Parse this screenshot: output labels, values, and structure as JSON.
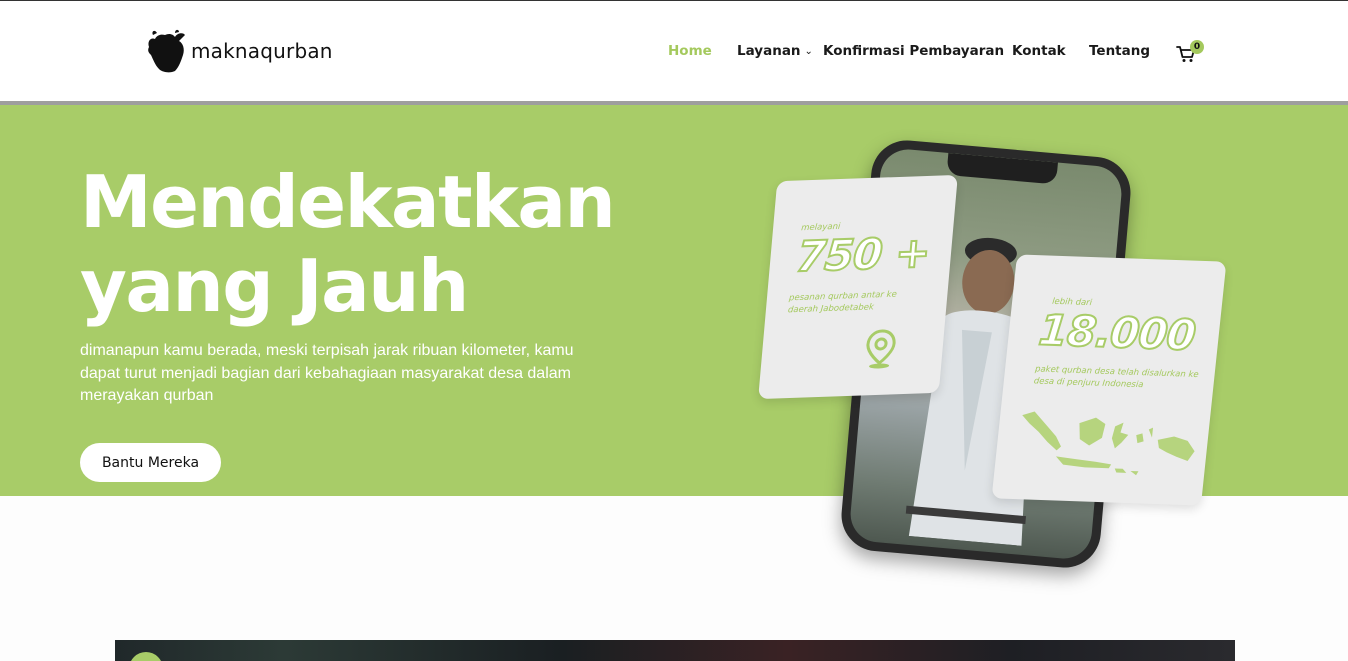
{
  "brand": {
    "name": "maknaqurban",
    "logo_icon": "bull-head-icon"
  },
  "nav": {
    "items": [
      {
        "label": "Home",
        "active": true
      },
      {
        "label": "Layanan",
        "has_dropdown": true
      },
      {
        "label": "Konfirmasi Pembayaran"
      },
      {
        "label": "Kontak"
      },
      {
        "label": "Tentang"
      }
    ],
    "cart": {
      "icon": "cart-icon",
      "count": "0"
    }
  },
  "hero": {
    "title": "Mendekatkan\nyang Jauh",
    "subtitle": "dimanapun kamu berada, meski terpisah jarak ribuan kilometer, kamu dapat turut menjadi bagian dari kebahagiaan masyarakat desa dalam merayakan qurban",
    "cta_label": "Bantu Mereka",
    "card1": {
      "kicker": "melayani",
      "number": "750 +",
      "caption": "pesanan qurban antar ke daerah Jabodetabek",
      "icon": "location-pin-icon"
    },
    "card2": {
      "kicker": "lebih dari",
      "number": "18.000",
      "caption": "paket qurban desa telah disalurkan ke desa di penjuru Indonesia",
      "icon": "indonesia-map-icon"
    }
  },
  "colors": {
    "accent": "#a8cc68",
    "nav_active": "#a4c95d",
    "text": "#111111"
  }
}
